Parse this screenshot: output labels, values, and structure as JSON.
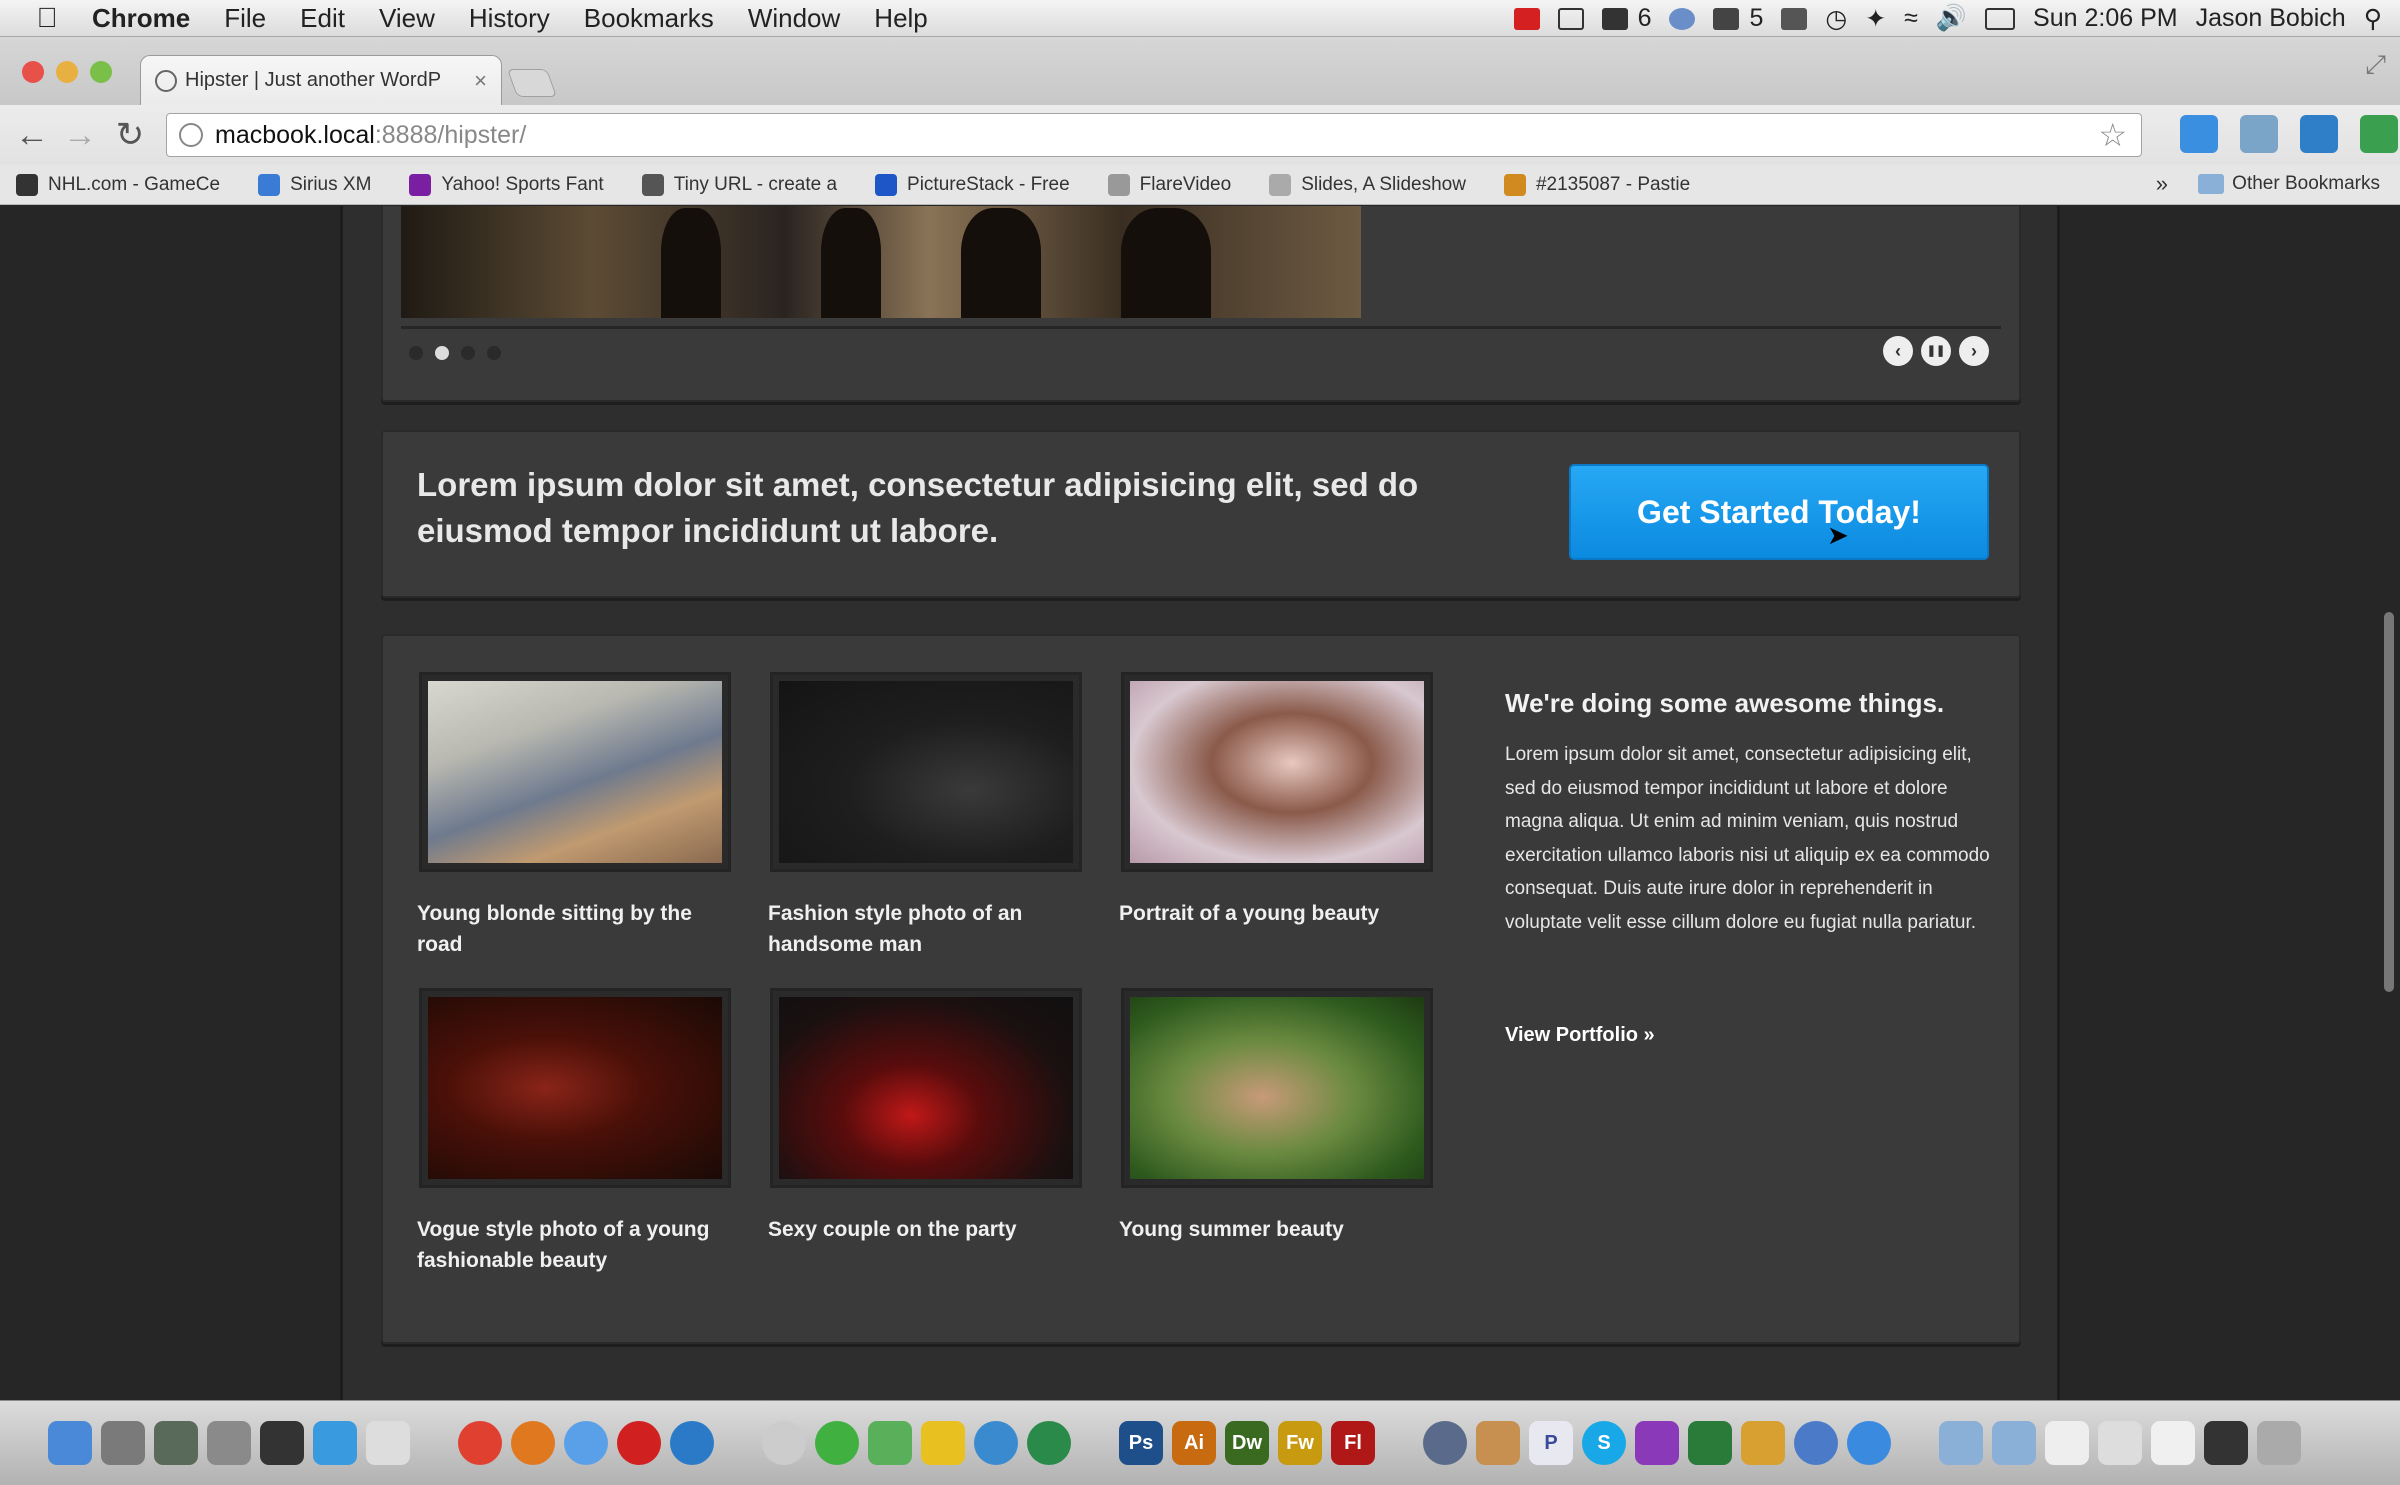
{
  "menubar": {
    "app": "Chrome",
    "items": [
      "File",
      "Edit",
      "View",
      "History",
      "Bookmarks",
      "Window",
      "Help"
    ],
    "mail_count": "6",
    "adobe_count": "5",
    "clock": "Sun 2:06 PM",
    "user": "Jason Bobich"
  },
  "browser": {
    "tab_title": "Hipster | Just another WordP",
    "tab_close": "×",
    "url_host": "macbook.local",
    "url_rest": ":8888/hipster/",
    "bookmarks": [
      {
        "label": "NHL.com - GameCe",
        "color": "#333"
      },
      {
        "label": "Sirius XM",
        "color": "#3a7bd5"
      },
      {
        "label": "Yahoo! Sports Fant",
        "color": "#7b1fa2"
      },
      {
        "label": "Tiny URL - create a",
        "color": "#555"
      },
      {
        "label": "PictureStack - Free",
        "color": "#1e56c8"
      },
      {
        "label": "FlareVideo",
        "color": "#999"
      },
      {
        "label": "Slides, A Slideshow",
        "color": "#aaa"
      },
      {
        "label": "#2135087 - Pastie",
        "color": "#d08a20"
      }
    ],
    "other_bookmarks": "Other Bookmarks"
  },
  "slider": {
    "dots": 4,
    "active_dot": 1,
    "nav": [
      "‹",
      "❚❚",
      "›"
    ]
  },
  "cta": {
    "text": "Lorem ipsum dolor sit amet, consectetur adipisicing elit, sed do eiusmod tempor incididunt ut labore.",
    "button": "Get Started Today!"
  },
  "portfolio": {
    "items": [
      {
        "caption": "Young blonde sitting by the road"
      },
      {
        "caption": "Fashion style photo of an handsome man"
      },
      {
        "caption": "Portrait of a young beauty"
      },
      {
        "caption": "Vogue style photo of a young fashionable beauty"
      },
      {
        "caption": "Sexy couple on the party"
      },
      {
        "caption": "Young summer beauty"
      }
    ],
    "heading": "We're doing some awesome things.",
    "body": "Lorem ipsum dolor sit amet, consectetur adipisicing elit, sed do eiusmod tempor incididunt ut labore et dolore magna aliqua. Ut enim ad minim veniam, quis nostrud exercitation ullamco laboris nisi ut aliquip ex ea commodo consequat. Duis aute irure dolor in reprehenderit in voluptate velit esse cillum dolore eu fugiat nulla pariatur.",
    "link": "View Portfolio »"
  },
  "dock": {
    "photoshop": "Ps",
    "illustrator": "Ai",
    "dreamweaver": "Dw",
    "fireworks": "Fw",
    "flash": "Fl",
    "pages": "P",
    "skype": "S"
  }
}
